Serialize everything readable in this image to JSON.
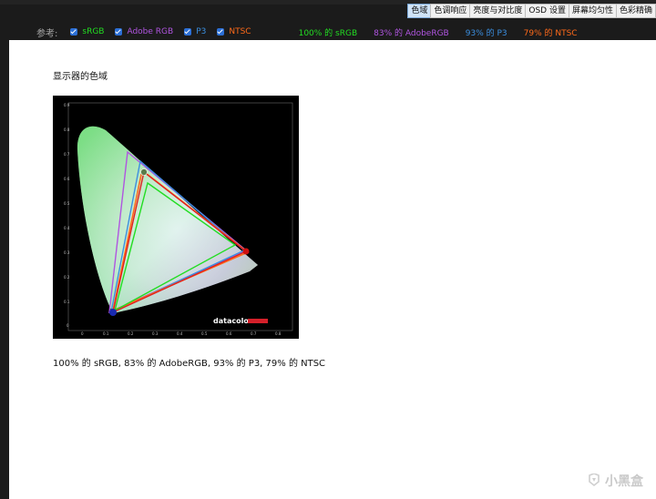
{
  "tabs": [
    {
      "label": "色域",
      "active": true
    },
    {
      "label": "色调响应",
      "active": false
    },
    {
      "label": "亮度与对比度",
      "active": false
    },
    {
      "label": "OSD 设置",
      "active": false
    },
    {
      "label": "屏幕均匀性",
      "active": false
    },
    {
      "label": "色彩精确",
      "active": false
    }
  ],
  "legend": {
    "reference_label": "参考:",
    "items": [
      {
        "label": "sRGB",
        "color": "#22dd22"
      },
      {
        "label": "Adobe RGB",
        "color": "#b055e0"
      },
      {
        "label": "P3",
        "color": "#3b8fe0"
      },
      {
        "label": "NTSC",
        "color": "#ff6a1a"
      }
    ],
    "coverage": [
      {
        "text": "100% 的 sRGB",
        "color": "#22dd22"
      },
      {
        "text": "83% 的 AdobeRGB",
        "color": "#b055e0"
      },
      {
        "text": "93% 的 P3",
        "color": "#3b8fe0"
      },
      {
        "text": "79% 的 NTSC",
        "color": "#ff6a1a"
      }
    ]
  },
  "content": {
    "heading": "显示器的色域",
    "caption": "100% 的 sRGB, 83% 的 AdobeRGB, 93% 的 P3, 79% 的 NTSC"
  },
  "figure": {
    "brand": "datacolor",
    "x_ticks": [
      "0",
      "0.1",
      "0.2",
      "0.3",
      "0.4",
      "0.5",
      "0.6",
      "0.7",
      "0.8"
    ],
    "y_ticks": [
      "0.9",
      "0.8",
      "0.7",
      "0.6",
      "0.5",
      "0.4",
      "0.3",
      "0.2",
      "0.1",
      "0"
    ]
  },
  "watermark": {
    "text": "小黑盒"
  }
}
